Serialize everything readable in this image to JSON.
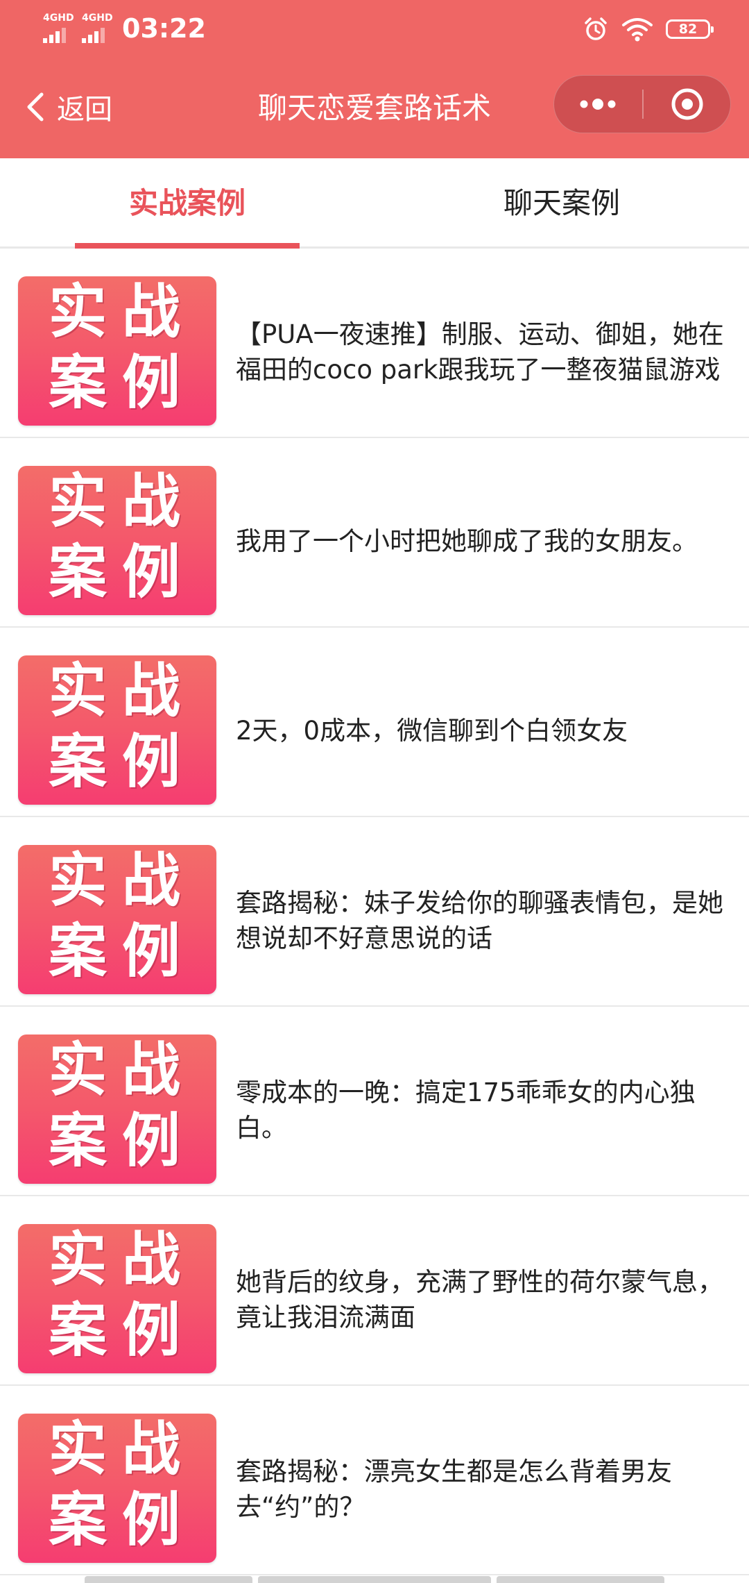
{
  "status_bar": {
    "time": "03:22",
    "network_1": "4GHD",
    "network_2": "4GHD",
    "battery": "82",
    "icons": [
      "signal-icon",
      "signal-icon",
      "alarm-icon",
      "wifi-icon",
      "battery-icon"
    ]
  },
  "nav": {
    "back_label": "返回",
    "title": "聊天恋爱套路话术",
    "more_icon": "more-dots-icon",
    "close_icon": "target-circle-icon"
  },
  "tabs": [
    {
      "label": "实战案例",
      "active": true
    },
    {
      "label": "聊天案例",
      "active": false
    }
  ],
  "thumbnail": {
    "chars": [
      "实",
      "战",
      "案",
      "例"
    ]
  },
  "items": [
    {
      "title": "【PUA一夜速推】制服、运动、御姐，她在福田的coco park跟我玩了一整夜猫鼠游戏"
    },
    {
      "title": "我用了一个小时把她聊成了我的女朋友。"
    },
    {
      "title": "2天，0成本，微信聊到个白领女友"
    },
    {
      "title": "套路揭秘：妹子发给你的聊骚表情包，是她想说却不好意思说的话"
    },
    {
      "title": "零成本的一晚：搞定175乖乖女的内心独白。"
    },
    {
      "title": "她背后的纹身，充满了野性的荷尔蒙气息，竟让我泪流满面"
    },
    {
      "title": "套路揭秘：漂亮女生都是怎么背着男友去“约”的？"
    }
  ],
  "colors": {
    "header": "#ef6665",
    "accent": "#e9535a",
    "divider": "#e8e8e8"
  }
}
